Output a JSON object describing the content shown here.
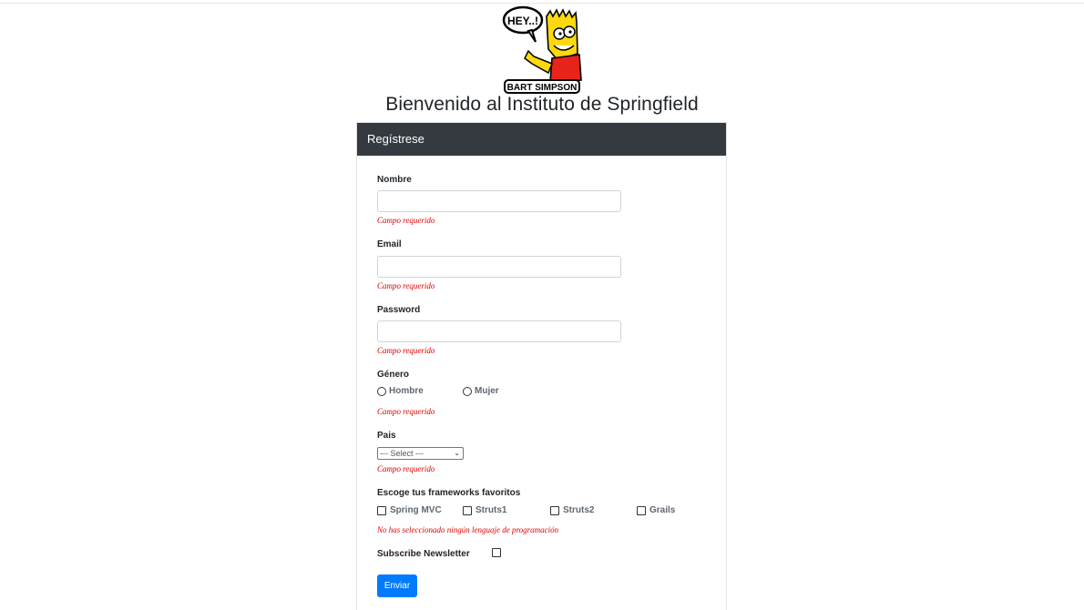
{
  "logo": {
    "bubble_text": "HEY..!",
    "caption": "BART SIMPSON"
  },
  "page_title": "Bienvenido al Instituto de Springfield",
  "card": {
    "header": "Regístrese"
  },
  "form": {
    "nombre": {
      "label": "Nombre",
      "value": "",
      "error": "Campo requerido"
    },
    "email": {
      "label": "Email",
      "value": "",
      "error": "Campo requerido"
    },
    "password": {
      "label": "Password",
      "value": "",
      "error": "Campo requerido"
    },
    "genero": {
      "label": "Género",
      "options": [
        "Hombre",
        "Mujer"
      ],
      "error": "Campo requerido"
    },
    "pais": {
      "label": "Pais",
      "selected": "--- Select ---",
      "error": "Campo requerido"
    },
    "frameworks": {
      "label": "Escoge tus frameworks favoritos",
      "options": [
        "Spring MVC",
        "Struts1",
        "Struts2",
        "Grails"
      ],
      "error": "No has seleccionado ningún lenguaje de programación"
    },
    "newsletter": {
      "label": "Subscribe Newsletter",
      "checked": false
    },
    "submit_label": "Enviar"
  },
  "colors": {
    "header_bg": "#343a40",
    "error": "#e00000",
    "primary": "#007bff"
  }
}
